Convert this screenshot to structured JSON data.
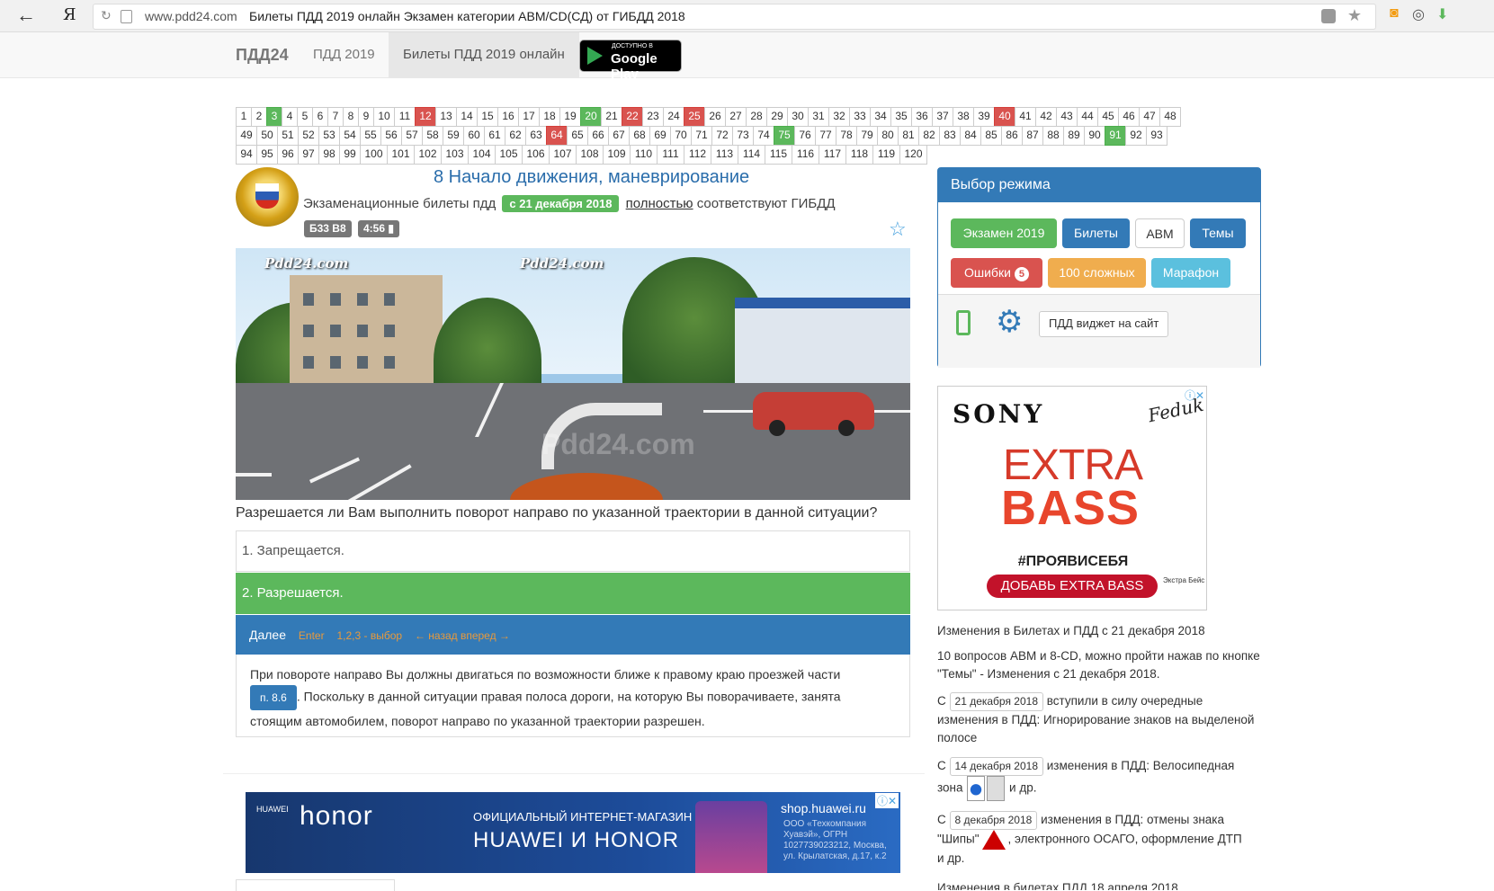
{
  "browser": {
    "back_icon": "←",
    "logo": "Я",
    "reload_icon": "↻",
    "domain": "www.pdd24.com",
    "title": "Билеты ПДД 2019 онлайн Экзамен категории ABM/CD(СД) от ГИБДД 2018"
  },
  "nav": {
    "brand": "ПДД24",
    "link1": "ПДД 2019",
    "active": "Билеты ПДД 2019 онлайн",
    "gplay_small": "ДОСТУПНО В",
    "gplay_big": "Google Play"
  },
  "question_numbers": {
    "rows": [
      [
        1,
        2,
        3,
        4,
        5,
        6,
        7,
        8,
        9,
        10,
        11,
        12,
        13,
        14,
        15,
        16,
        17,
        18,
        19,
        20,
        21,
        22,
        23,
        24,
        25,
        26,
        27,
        28,
        29,
        30,
        31,
        32,
        33,
        34,
        35,
        36,
        37,
        38,
        39,
        40,
        41,
        42,
        43,
        44,
        45,
        46,
        47,
        48
      ],
      [
        49,
        50,
        51,
        52,
        53,
        54,
        55,
        56,
        57,
        58,
        59,
        60,
        61,
        62,
        63,
        64,
        65,
        66,
        67,
        68,
        69,
        70,
        71,
        72,
        73,
        74,
        75,
        76,
        77,
        78,
        79,
        80,
        81,
        82,
        83,
        84,
        85,
        86,
        87,
        88,
        89,
        90,
        91,
        92,
        93
      ],
      [
        94,
        95,
        96,
        97,
        98,
        99,
        100,
        101,
        102,
        103,
        104,
        105,
        106,
        107,
        108,
        109,
        110,
        111,
        112,
        113,
        114,
        115,
        116,
        117,
        118,
        119,
        120
      ]
    ],
    "correct": [
      3,
      20,
      75,
      91
    ],
    "wrong": [
      12,
      22,
      25,
      40,
      64
    ],
    "correct_color": "#5cb85c",
    "wrong_color": "#d9534f"
  },
  "question": {
    "title": "8 Начало движения, маневрирование",
    "subtitle_pre": "Экзаменационные билеты пдд",
    "subtitle_date": "с 21 декабря 2018",
    "subtitle_link": "полностью",
    "subtitle_post": "соответствуют ГИБДД",
    "badge_ticket": "Б33 В8",
    "badge_timer": "4:56 ▮",
    "favorite_icon": "☆",
    "watermark": "Pdd24.com",
    "text": "Разрешается ли Вам выполнить поворот направо по указанной траектории в данной ситуации?",
    "answers": [
      "1. Запрещается.",
      "2. Разрешается."
    ],
    "selected_answer": 2,
    "next_label": "Далее",
    "next_hint_enter": "Enter",
    "next_hint_choose": "1,2,3 - выбор",
    "next_hint_nav": "← назад   вперед →",
    "explanation_1": "При повороте направо Вы должны двигаться по возможности ближе к правому краю проезжей части",
    "explanation_rule": "п. 8.6",
    "explanation_2": ". Поскольку в данной ситуации правая полоса дороги, на которую Вы поворачиваете, занята",
    "explanation_3": "стоящим автомобилем, поворот направо по указанной траектории разрешен."
  },
  "mode_panel": {
    "title": "Выбор режима",
    "exam": "Экзамен 2019",
    "tickets": "Билеты",
    "abm": "ABM",
    "themes": "Темы",
    "errors": "Ошибки",
    "errors_count": "5",
    "hard": "100 сложных",
    "marathon": "Марафон",
    "widget": "ПДД виджет на сайт",
    "phone_icon": "mobile-phone-icon",
    "gear_icon": "⚙"
  },
  "ad_sony": {
    "brand": "SONY",
    "artist": "Feduk",
    "extra": "EXTRA",
    "bass": "BASS",
    "hashtag": "#ПРОЯВИСЕБЯ",
    "cta": "ДОБАВЬ EXTRA BASS",
    "small": "Экстра Бейс",
    "adchoice": "ⓘ✕"
  },
  "news": {
    "n1": "Изменения в Билетах и ПДД с 21 декабря 2018",
    "n2": "10 вопросов ABM и 8-CD, можно пройти нажав по кнопке \"Темы\" - Изменения с 21 декабря 2018.",
    "n3_pre": "С",
    "n3_date": "21 декабря 2018",
    "n3_post": "вступили в силу очередные изменения в ПДД: Игнорирование знаков на выделеной полосе",
    "n4_pre": "С",
    "n4_date": "14 декабря 2018",
    "n4_mid": "изменения в ПДД: Велосипедная",
    "n4_zone": "зона",
    "n4_end": "и др.",
    "n5_pre": "С",
    "n5_date": "8 декабря 2018",
    "n5_mid": "изменения в ПДД: отмены знака",
    "n5_sign": "\"Шипы\"",
    "n5_end": ", электронного ОСАГО, оформление ДТП",
    "n5_tail": "и др.",
    "n6": "Изменения в билетах ПДД 18 апреля 2018"
  },
  "ad_huawei": {
    "huawei": "HUAWEI",
    "honor": "honor",
    "line1": "ОФИЦИАЛЬНЫЙ ИНТЕРНЕТ-МАГАЗИН",
    "line2": "HUAWEI И HONOR",
    "shop": "shop.huawei.ru",
    "fine": "ООО «Техкомпания Хуавэй», ОГРН 1027739023212, Москва, ул. Крылатская, д.17, к.2",
    "adchoice": "ⓘ✕"
  }
}
